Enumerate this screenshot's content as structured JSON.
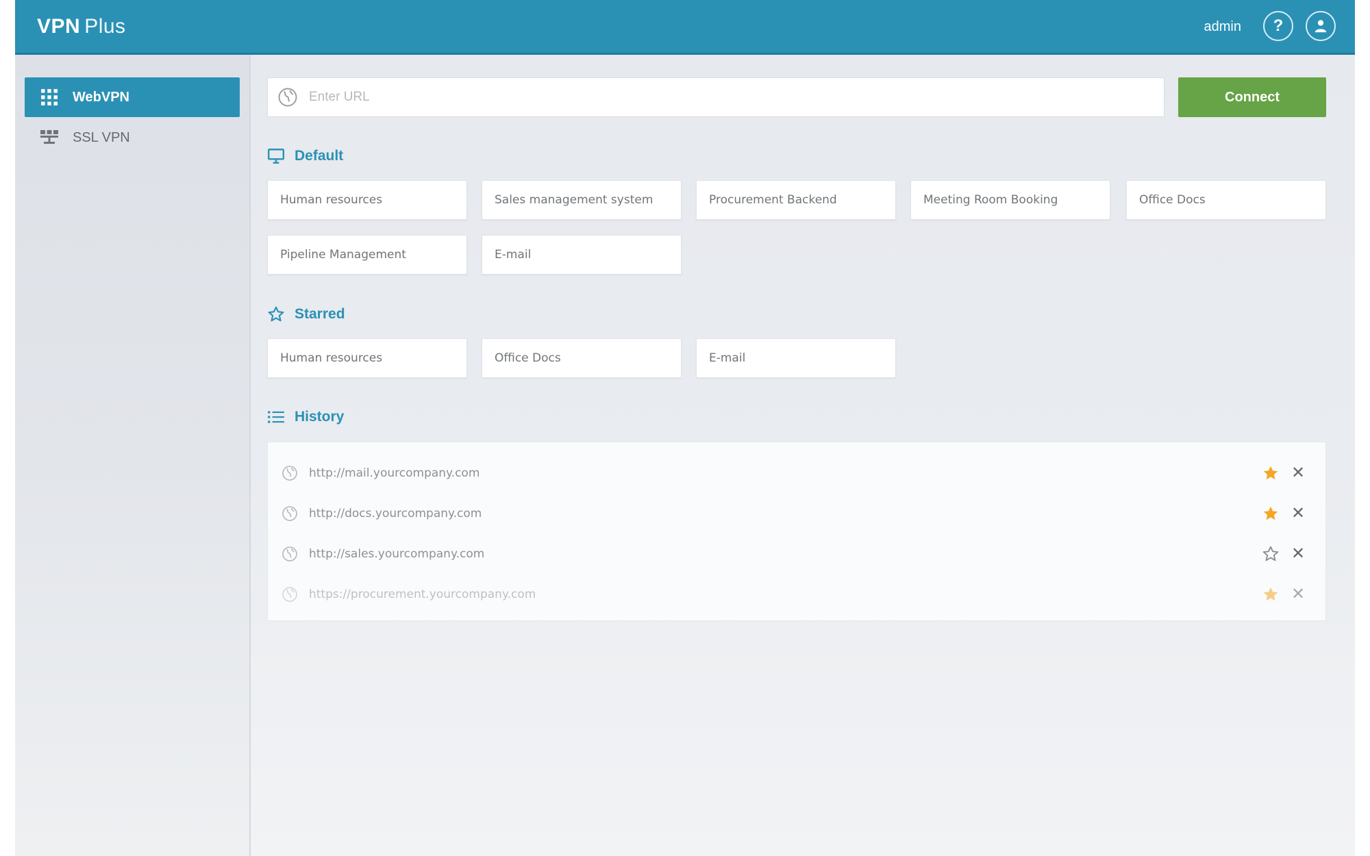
{
  "header": {
    "brand_bold": "VPN",
    "brand_light": "Plus",
    "user": "admin",
    "help_label": "?"
  },
  "sidebar": {
    "items": [
      {
        "label": "WebVPN",
        "icon": "grid-icon",
        "active": true
      },
      {
        "label": "SSL VPN",
        "icon": "network-icon",
        "active": false
      }
    ]
  },
  "url_input": {
    "placeholder": "Enter URL",
    "value": ""
  },
  "connect_label": "Connect",
  "sections": {
    "default": {
      "title": "Default",
      "items": [
        "Human resources",
        "Sales management system",
        "Procurement Backend",
        "Meeting Room Booking",
        "Office Docs",
        "Pipeline Management",
        "E-mail"
      ]
    },
    "starred": {
      "title": "Starred",
      "items": [
        "Human resources",
        "Office Docs",
        "E-mail"
      ]
    },
    "history": {
      "title": "History",
      "items": [
        {
          "url": "http://mail.yourcompany.com",
          "starred": true
        },
        {
          "url": "http://docs.yourcompany.com",
          "starred": true
        },
        {
          "url": "http://sales.yourcompany.com",
          "starred": false
        },
        {
          "url": "https://procurement.yourcompany.com",
          "starred": true
        }
      ]
    }
  },
  "colors": {
    "primary": "#2a91b5",
    "connect": "#67a347",
    "star": "#f5a623"
  }
}
